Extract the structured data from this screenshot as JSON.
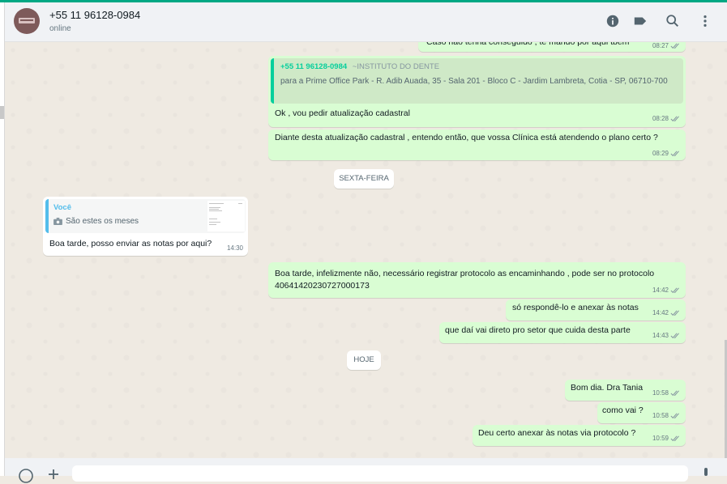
{
  "header": {
    "contact_name": "+55 11 96128-0984",
    "status": "online"
  },
  "icons": {
    "info": "info-icon",
    "label": "label-icon",
    "search": "search-icon",
    "menu": "more-vertical-icon"
  },
  "colors": {
    "accent": "#00a884",
    "outgoing_bubble": "#d9fdd3",
    "incoming_bubble": "#ffffff",
    "read_ticks": "#53bdeb",
    "sent_ticks": "#8696a0",
    "quoted_author_out": "#06cf9c",
    "quoted_author_in": "#53bdeb"
  },
  "messages": {
    "m0": {
      "text": "Caso não tenha conseguido , te mando por aqui tbem",
      "time": "08:27"
    },
    "m1": {
      "quote_author": "+55 11 96128-0984",
      "quote_sender_name": "~INSTITUTO DO DENTE",
      "quote_text": "para a Prime Office Park - R. Adib Auada, 35 - Sala 201 - Bloco C - Jardim Lambreta, Cotia - SP, 06710-700",
      "text": "Ok , vou pedir atualização cadastral",
      "time": "08:28"
    },
    "m2": {
      "text": "Diante desta atualização cadastral , entendo então, que vossa Clínica está atendendo o plano certo ?",
      "time": "08:29"
    },
    "day1": "SEXTA-FEIRA",
    "m3": {
      "quote_author": "Você",
      "quote_text": "São estes os meses",
      "text": "Boa tarde, posso enviar as notas por aqui?",
      "time": "14:30"
    },
    "m4": {
      "text": "Boa tarde, infelizmente não, necessário registrar protocolo as encaminhando , pode ser no protocolo 40641420230727000173",
      "time": "14:42"
    },
    "m5": {
      "text": "só respondê-lo e anexar às notas",
      "time": "14:42"
    },
    "m6": {
      "text": "que daí vai direto pro setor que cuida desta parte",
      "time": "14:43"
    },
    "day2": "HOJE",
    "m7": {
      "text": "Bom dia. Dra Tania",
      "time": "10:58"
    },
    "m8": {
      "text": "como vai ?",
      "time": "10:58"
    },
    "m9": {
      "text": "Deu certo anexar às notas via protocolo ?",
      "time": "10:59"
    }
  },
  "footer": {
    "emoji": "emoji-icon",
    "attach": "attach-icon",
    "mic": "mic-icon"
  }
}
